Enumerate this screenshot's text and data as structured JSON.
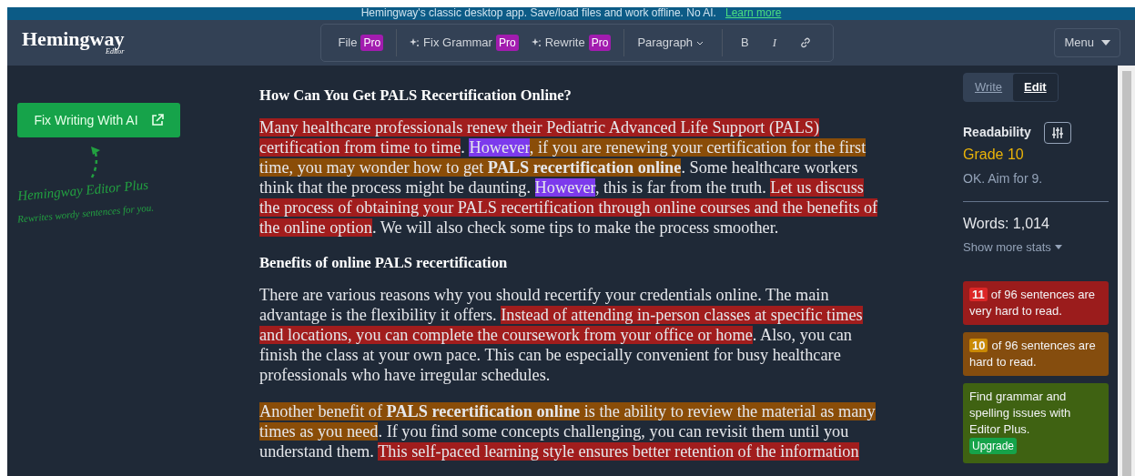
{
  "banner": {
    "text": "Hemingway's classic desktop app. Save/load files and work offline. No AI.",
    "link": "Learn more"
  },
  "navbar": {
    "logo": "Hemingway",
    "logo_sub": "Editor",
    "toolbar": [
      [
        {
          "kind": "menu",
          "label": "File",
          "badge": "Pro"
        }
      ],
      [
        {
          "kind": "sparkle",
          "label": "Fix Grammar",
          "badge": "Pro"
        },
        {
          "kind": "sparkle",
          "label": "Rewrite",
          "badge": "Pro"
        }
      ],
      [
        {
          "kind": "dropdown",
          "label": "Paragraph"
        }
      ],
      [
        {
          "kind": "bold",
          "label": "B"
        },
        {
          "kind": "italic",
          "label": "I"
        },
        {
          "kind": "link"
        }
      ]
    ],
    "menu": "Menu"
  },
  "sidebar": {
    "button": "Fix Writing With AI",
    "promo_title": "Hemingway Editor Plus",
    "promo_text": "Rewrites wordy sentences for you."
  },
  "document": [
    {
      "kind": "heading",
      "segments": [
        {
          "kind": "plain",
          "text": "How Can You Get PALS Recertification Online?"
        }
      ]
    },
    {
      "kind": "paragraph",
      "segments": [
        {
          "kind": "very_hard",
          "text": "Many healthcare professionals renew their Pediatric Advanced Life Support (PALS) certification from time to time"
        },
        {
          "kind": "plain",
          "text": ". "
        },
        {
          "kind": "simpler",
          "text": "However"
        },
        {
          "kind": "hard",
          "text": ", if you are renewing your certification for the first time, you may wonder how to get **PALS recertification online**"
        },
        {
          "kind": "plain",
          "text": ". Some healthcare workers think that the process might be daunting. "
        },
        {
          "kind": "simpler",
          "text": "However"
        },
        {
          "kind": "plain",
          "text": ", this is far from the truth. "
        },
        {
          "kind": "very_hard",
          "text": "Let us discuss the process of obtaining your PALS recertification through online courses and the benefits of the online option"
        },
        {
          "kind": "plain",
          "text": ". We will also check some tips to make the process smoother."
        }
      ]
    },
    {
      "kind": "heading",
      "segments": [
        {
          "kind": "plain",
          "text": "Benefits of online PALS recertification"
        }
      ]
    },
    {
      "kind": "paragraph",
      "segments": [
        {
          "kind": "plain",
          "text": "There are various reasons why you should recertify your credentials online. The main advantage is the flexibility it offers. "
        },
        {
          "kind": "very_hard",
          "text": "Instead of attending in-person classes at specific times and locations, you can complete the coursework from your office or home"
        },
        {
          "kind": "plain",
          "text": ". Also, you can finish the class at your own pace. This can be especially convenient for busy healthcare professionals who have irregular schedules."
        }
      ]
    },
    {
      "kind": "paragraph",
      "segments": [
        {
          "kind": "hard",
          "text": "Another benefit of **PALS recertification online** is the ability to review the material as many times as you need"
        },
        {
          "kind": "plain",
          "text": ". If you find some concepts challenging, you can revisit them until you understand them. "
        },
        {
          "kind": "very_hard",
          "text": "This self-paced learning style ensures better retention of the information"
        }
      ]
    }
  ],
  "panel": {
    "tabs": [
      {
        "label": "Write",
        "selected": false
      },
      {
        "label": "Edit",
        "selected": true
      }
    ],
    "readability_label": "Readability",
    "grade": "Grade 10",
    "grade_note": "OK. Aim for 9.",
    "words": "Words: 1,014",
    "more_stats": "Show more stats",
    "cards": [
      {
        "kind": "very_hard",
        "count": "11",
        "text": "of 96 sentences are very hard to read."
      },
      {
        "kind": "hard",
        "count": "10",
        "text": "of 96 sentences are hard to read."
      },
      {
        "kind": "promo",
        "text": "Find grammar and spelling issues with Editor Plus.",
        "button": "Upgrade"
      }
    ]
  }
}
